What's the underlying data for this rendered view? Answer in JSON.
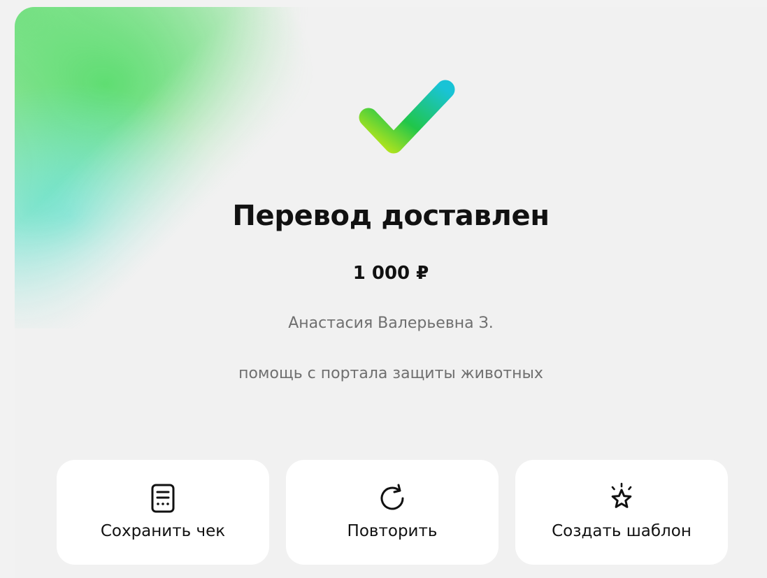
{
  "status": {
    "title": "Перевод доставлен",
    "amount": "1 000 ₽",
    "recipient": "Анастасия Валерьевна З.",
    "comment": "помощь с портала защиты животных",
    "icon": "checkmark-icon"
  },
  "actions": [
    {
      "label": "Сохранить чек",
      "icon": "receipt-icon"
    },
    {
      "label": "Повторить",
      "icon": "repeat-icon"
    },
    {
      "label": "Создать шаблон",
      "icon": "star-icon"
    }
  ],
  "colors": {
    "background": "#f2f2f2",
    "button_background": "#ffffff",
    "text_primary": "#111111",
    "text_secondary": "#6f6f6f",
    "check_gradient": [
      "#c6e817",
      "#21c64a",
      "#19c3d6"
    ]
  }
}
